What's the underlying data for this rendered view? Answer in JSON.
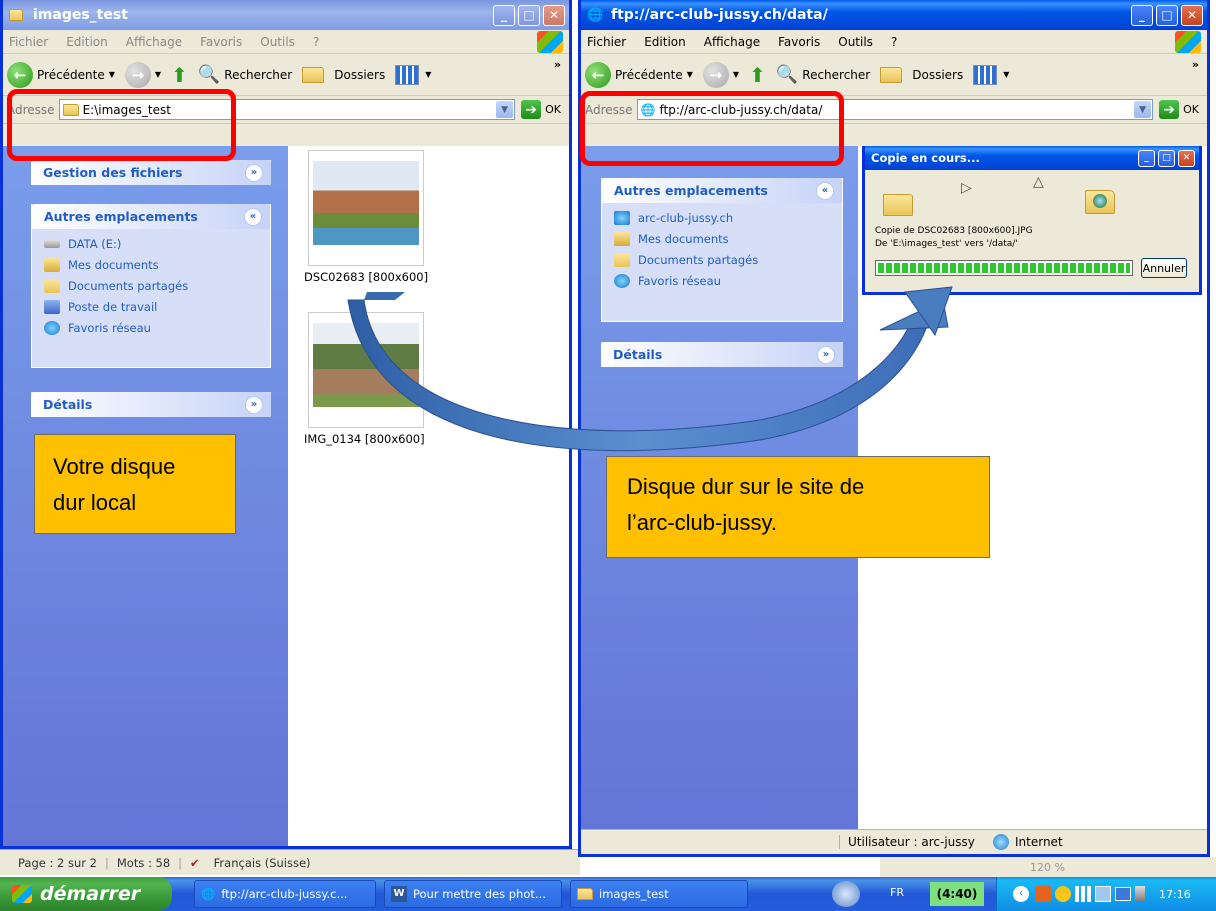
{
  "left_window": {
    "title": "images_test",
    "menu": [
      "Fichier",
      "Edition",
      "Affichage",
      "Favoris",
      "Outils",
      "?"
    ],
    "toolbar": {
      "back": "Précédente",
      "search": "Rechercher",
      "folders": "Dossiers"
    },
    "address": {
      "label": "Adresse",
      "value": "E:\\images_test",
      "go": "OK"
    },
    "panel_file_tasks": "Gestion des fichiers",
    "panel_other": {
      "title": "Autres emplacements",
      "items": [
        "DATA (E:)",
        "Mes documents",
        "Documents partagés",
        "Poste de travail",
        "Favoris réseau"
      ]
    },
    "panel_details": "Détails",
    "files": [
      "DSC02683 [800x600]",
      "IMG_0134 [800x600]"
    ]
  },
  "right_window": {
    "title": "ftp://arc-club-jussy.ch/data/",
    "menu": [
      "Fichier",
      "Edition",
      "Affichage",
      "Favoris",
      "Outils",
      "?"
    ],
    "toolbar": {
      "back": "Précédente",
      "search": "Rechercher",
      "folders": "Dossiers"
    },
    "address": {
      "label": "Adresse",
      "value": "ftp://arc-club-jussy.ch/data/",
      "go": "OK"
    },
    "panel_other": {
      "title": "Autres emplacements",
      "items": [
        "arc-club-jussy.ch",
        "Mes documents",
        "Documents partagés",
        "Favoris réseau"
      ]
    },
    "panel_details": "Détails",
    "status": {
      "user": "Utilisateur : arc-jussy",
      "zone": "Internet"
    }
  },
  "copy_dialog": {
    "title": "Copie en cours...",
    "line1": "Copie de DSC02683 [800x600].JPG",
    "line2": "De 'E:\\images_test' vers '/data/'",
    "progress": 1.0,
    "cancel": "Annuler"
  },
  "callouts": {
    "left_line1": "Votre disque",
    "left_line2": "dur local",
    "right_line1": "Disque dur sur le site de",
    "right_line2": "l’arc-club-jussy."
  },
  "word_status": {
    "page": "Page : 2 sur 2",
    "words": "Mots : 58",
    "lang": "Français (Suisse)",
    "zoom": "120 %"
  },
  "taskbar": {
    "start": "démarrer",
    "buttons": [
      "ftp://arc-club-jussy.c...",
      "Pour mettre des phot...",
      "images_test"
    ],
    "lang": "FR",
    "timer": "(4:40)",
    "clock": "17:16"
  },
  "colors": {
    "xp_blue": "#0831d9",
    "sidebar": "#6375d6",
    "callout": "#ffc000",
    "highlight": "#ff0000",
    "arrow": "#4a7cc0"
  }
}
